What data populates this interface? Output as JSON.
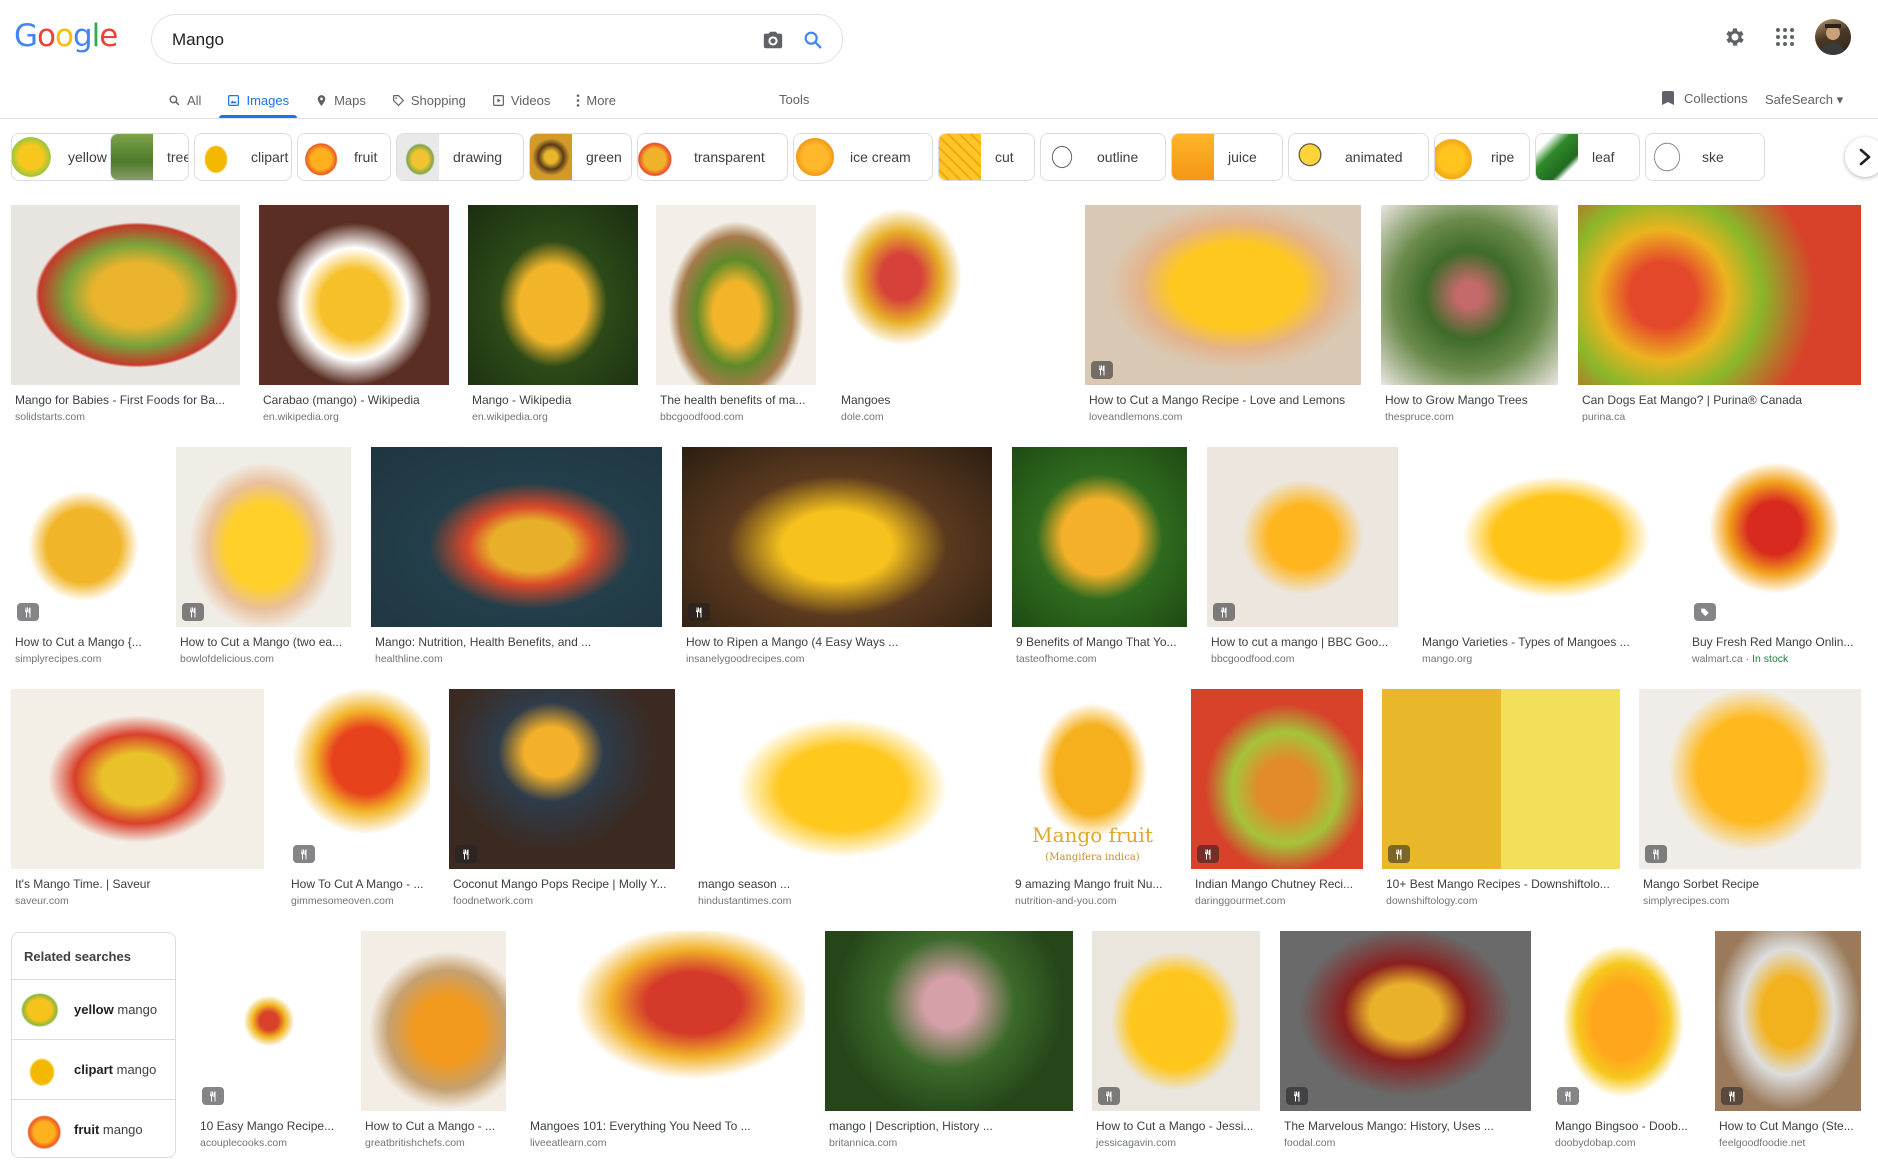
{
  "logo": {
    "letters": [
      "G",
      "o",
      "o",
      "g",
      "l",
      "e"
    ],
    "colors": [
      "#4285f4",
      "#ea4335",
      "#fbbc05",
      "#4285f4",
      "#34a853",
      "#ea4335"
    ]
  },
  "search": {
    "value": "Mango"
  },
  "tabs": [
    {
      "label": "All",
      "icon": "search-icon",
      "active": false
    },
    {
      "label": "Images",
      "icon": "image-icon",
      "active": true
    },
    {
      "label": "Maps",
      "icon": "map-pin-icon",
      "active": false
    },
    {
      "label": "Shopping",
      "icon": "tag-icon",
      "active": false
    },
    {
      "label": "Videos",
      "icon": "video-icon",
      "active": false
    },
    {
      "label": "More",
      "icon": "more-vertical-icon",
      "active": false
    }
  ],
  "tools_label": "Tools",
  "collections_label": "Collections",
  "safesearch_label": "SafeSearch",
  "chips": [
    {
      "label": "yellow"
    },
    {
      "label": "tree"
    },
    {
      "label": "clipart"
    },
    {
      "label": "fruit"
    },
    {
      "label": "drawing"
    },
    {
      "label": "green"
    },
    {
      "label": "transparent"
    },
    {
      "label": "ice cream"
    },
    {
      "label": "cut"
    },
    {
      "label": "outline"
    },
    {
      "label": "juice"
    },
    {
      "label": "animated"
    },
    {
      "label": "ripe"
    },
    {
      "label": "leaf"
    },
    {
      "label": "ske"
    }
  ],
  "results": [
    {
      "title": "Mango for Babies - First Foods for Ba...",
      "source": "solidstarts.com",
      "recipe": false
    },
    {
      "title": "Carabao (mango) - Wikipedia",
      "source": "en.wikipedia.org",
      "recipe": false
    },
    {
      "title": "Mango - Wikipedia",
      "source": "en.wikipedia.org",
      "recipe": false
    },
    {
      "title": "The health benefits of ma...",
      "source": "bbcgoodfood.com",
      "recipe": false
    },
    {
      "title": "Mangoes",
      "source": "dole.com",
      "recipe": false
    },
    {
      "title": "How to Cut a Mango Recipe - Love and Lemons",
      "source": "loveandlemons.com",
      "recipe": true
    },
    {
      "title": "How to Grow Mango Trees",
      "source": "thespruce.com",
      "recipe": false
    },
    {
      "title": "Can Dogs Eat Mango? | Purina® Canada",
      "source": "purina.ca",
      "recipe": false
    },
    {
      "title": "How to Cut a Mango {...",
      "source": "simplyrecipes.com",
      "recipe": true
    },
    {
      "title": "How to Cut a Mango (two ea...",
      "source": "bowlofdelicious.com",
      "recipe": true
    },
    {
      "title": "Mango: Nutrition, Health Benefits, and ...",
      "source": "healthline.com",
      "recipe": false
    },
    {
      "title": "How to Ripen a Mango (4 Easy Ways ...",
      "source": "insanelygoodrecipes.com",
      "recipe": true
    },
    {
      "title": "9 Benefits of Mango That Yo...",
      "source": "tasteofhome.com",
      "recipe": false
    },
    {
      "title": "How to cut a mango | BBC Goo...",
      "source": "bbcgoodfood.com",
      "recipe": true
    },
    {
      "title": "Mango Varieties - Types of Mangoes ...",
      "source": "mango.org",
      "recipe": false
    },
    {
      "title": "Buy Fresh Red Mango Onlin...",
      "source": "walmart.ca",
      "stock": "In stock",
      "recipe": false,
      "product": true
    },
    {
      "title": "It's Mango Time. | Saveur",
      "source": "saveur.com",
      "recipe": false
    },
    {
      "title": "How To Cut A Mango - ...",
      "source": "gimmesomeoven.com",
      "recipe": true
    },
    {
      "title": "Coconut Mango Pops Recipe | Molly Y...",
      "source": "foodnetwork.com",
      "recipe": true
    },
    {
      "title": "mango season ...",
      "source": "hindustantimes.com",
      "recipe": false
    },
    {
      "title": "9 amazing Mango fruit Nu...",
      "source": "nutrition-and-you.com",
      "recipe": false,
      "overlay": "Mango fruit",
      "overlay_sub": "(Mangifera indica)"
    },
    {
      "title": "Indian Mango Chutney Reci...",
      "source": "daringgourmet.com",
      "recipe": true
    },
    {
      "title": "10+ Best Mango Recipes - Downshiftolo...",
      "source": "downshiftology.com",
      "recipe": true
    },
    {
      "title": "Mango Sorbet Recipe",
      "source": "simplyrecipes.com",
      "recipe": true
    },
    {
      "title": "10 Easy Mango Recipe...",
      "source": "acouplecooks.com",
      "recipe": true
    },
    {
      "title": "How to Cut a Mango - ...",
      "source": "greatbritishchefs.com",
      "recipe": false
    },
    {
      "title": "Mangoes 101: Everything You Need To ...",
      "source": "liveeatlearn.com",
      "recipe": false
    },
    {
      "title": "mango | Description, History ...",
      "source": "britannica.com",
      "recipe": false
    },
    {
      "title": "How to Cut a Mango - Jessi...",
      "source": "jessicagavin.com",
      "recipe": true
    },
    {
      "title": "The Marvelous Mango: History, Uses ...",
      "source": "foodal.com",
      "recipe": true
    },
    {
      "title": "Mango Bingsoo - Doob...",
      "source": "doobydobap.com",
      "recipe": true
    },
    {
      "title": "How to Cut Mango (Ste...",
      "source": "feelgoodfoodie.net",
      "recipe": true
    }
  ],
  "related": {
    "title": "Related searches",
    "items": [
      {
        "bold": "yellow",
        "rest": " mango"
      },
      {
        "bold": "clipart",
        "rest": " mango"
      },
      {
        "bold": "fruit",
        "rest": " mango"
      }
    ]
  },
  "colors": {
    "accent": "#1a73e8",
    "text": "#202124",
    "muted": "#70757a",
    "border": "#dadce0",
    "stock": "#188038"
  }
}
